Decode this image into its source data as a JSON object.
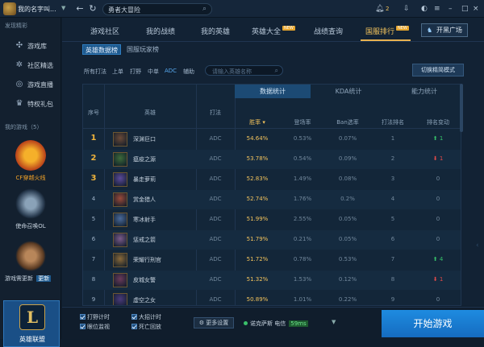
{
  "titlebar": {
    "username": "我的名字叫...",
    "search_value": "勇者大冒险",
    "notification_count": "2"
  },
  "sidebar": {
    "section_title": "发现精彩",
    "items": [
      {
        "label": "游戏库",
        "icon": "gamepad-icon"
      },
      {
        "label": "社区精选",
        "icon": "gear-icon"
      },
      {
        "label": "游戏直播",
        "icon": "live-icon"
      },
      {
        "label": "特权礼包",
        "icon": "gift-icon"
      }
    ],
    "my_games_title": "我的游戏（5）",
    "games": [
      {
        "name": "CF穿越火线",
        "color": "#f3a227"
      },
      {
        "name": "使命召唤OL",
        "color": "#c7d3df"
      },
      {
        "name": "游戏需更新",
        "update_label": "更新"
      },
      {
        "name": "英雄联盟"
      }
    ]
  },
  "tabs": [
    {
      "label": "游戏社区"
    },
    {
      "label": "我的战绩"
    },
    {
      "label": "我的英雄"
    },
    {
      "label": "英雄大全",
      "badge": "NEW"
    },
    {
      "label": "战绩查询"
    },
    {
      "label": "国服排行",
      "badge": "NEW"
    }
  ],
  "open_plaza_label": "开黑广场",
  "subtabs": [
    {
      "label": "英雄数据榜"
    },
    {
      "label": "国服玩家榜"
    }
  ],
  "filters": [
    {
      "label": "所有打法"
    },
    {
      "label": "上单"
    },
    {
      "label": "打野"
    },
    {
      "label": "中单"
    },
    {
      "label": "ADC"
    },
    {
      "label": "辅助"
    }
  ],
  "hero_search_placeholder": "请输入英雄名称",
  "mode_button_label": "切换精简模式",
  "table": {
    "col_rank": "序号",
    "col_hero": "英雄",
    "col_role": "打法",
    "groups": [
      "数据统计",
      "KDA统计",
      "能力统计"
    ],
    "cols": [
      "胜率",
      "登场率",
      "Ban选率",
      "打法排名",
      "排名变动"
    ],
    "rows": [
      {
        "rank": "1",
        "name": "深渊巨口",
        "role": "ADC",
        "win": "54.64%",
        "pick": "0.53%",
        "ban": "0.07%",
        "role_rank": "1",
        "change": "1",
        "dir": "up",
        "av": "#6b4a38"
      },
      {
        "rank": "2",
        "name": "瘟疫之源",
        "role": "ADC",
        "win": "53.78%",
        "pick": "0.54%",
        "ban": "0.09%",
        "role_rank": "2",
        "change": "1",
        "dir": "down",
        "av": "#3d6b3a"
      },
      {
        "rank": "3",
        "name": "暴走萝莉",
        "role": "ADC",
        "win": "52.83%",
        "pick": "1.49%",
        "ban": "0.08%",
        "role_rank": "3",
        "change": "0",
        "dir": "none",
        "av": "#5b4a9a"
      },
      {
        "rank": "4",
        "name": "赏金猎人",
        "role": "ADC",
        "win": "52.74%",
        "pick": "1.76%",
        "ban": "0.2%",
        "role_rank": "4",
        "change": "0",
        "dir": "none",
        "av": "#9a4a3a"
      },
      {
        "rank": "5",
        "name": "寒冰射手",
        "role": "ADC",
        "win": "51.99%",
        "pick": "2.55%",
        "ban": "0.05%",
        "role_rank": "5",
        "change": "0",
        "dir": "none",
        "av": "#4a6a9a"
      },
      {
        "rank": "6",
        "name": "惩戒之箭",
        "role": "ADC",
        "win": "51.79%",
        "pick": "0.21%",
        "ban": "0.05%",
        "role_rank": "6",
        "change": "0",
        "dir": "none",
        "av": "#7a5a8a"
      },
      {
        "rank": "7",
        "name": "荣耀行刑官",
        "role": "ADC",
        "win": "51.72%",
        "pick": "0.78%",
        "ban": "0.53%",
        "role_rank": "7",
        "change": "4",
        "dir": "up",
        "av": "#8a6a3a"
      },
      {
        "rank": "8",
        "name": "皮城女警",
        "role": "ADC",
        "win": "51.32%",
        "pick": "1.53%",
        "ban": "0.12%",
        "role_rank": "8",
        "change": "1",
        "dir": "down",
        "av": "#6a3a5a"
      },
      {
        "rank": "9",
        "name": "虚空之女",
        "role": "ADC",
        "win": "50.89%",
        "pick": "1.01%",
        "ban": "0.22%",
        "role_rank": "9",
        "change": "0",
        "dir": "none",
        "av": "#4a3a7a"
      }
    ]
  },
  "bottom": {
    "checks": [
      "打野计时",
      "大招计时",
      "眼位监视",
      "死亡回放"
    ],
    "more_settings": "更多设置",
    "server": "诺克萨斯 电信",
    "ping": "59ms",
    "start": "开始游戏"
  }
}
